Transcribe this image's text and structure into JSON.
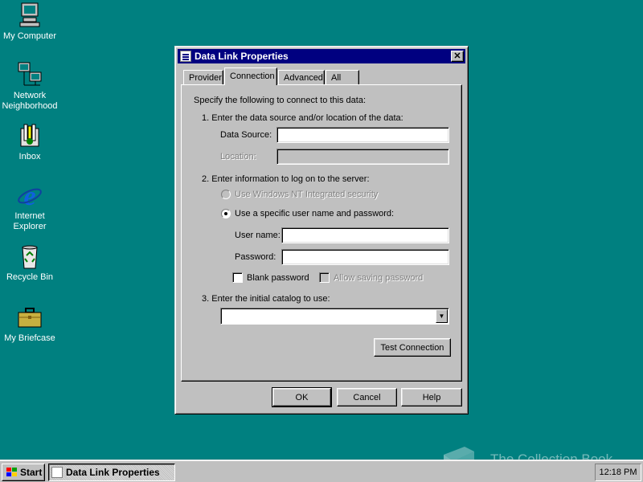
{
  "desktop": {
    "icons": [
      {
        "label": "My Computer"
      },
      {
        "label": "Network Neighborhood"
      },
      {
        "label": "Inbox"
      },
      {
        "label": "Internet Explorer"
      },
      {
        "label": "Recycle Bin"
      },
      {
        "label": "My Briefcase"
      }
    ]
  },
  "window": {
    "title": "Data Link Properties",
    "close_glyph": "✕",
    "tabs": [
      {
        "label": "Provider"
      },
      {
        "label": "Connection",
        "active": true
      },
      {
        "label": "Advanced"
      },
      {
        "label": "All"
      }
    ],
    "connection": {
      "intro": "Specify the following to connect to this data:",
      "step1": "1. Enter the data source and/or location of the data:",
      "data_source_label": "Data Source:",
      "data_source_value": "",
      "location_label": "Location:",
      "location_value": "",
      "step2": "2. Enter information to log on to the server:",
      "radio_nt": "Use Windows NT Integrated security",
      "radio_specific": "Use a specific user name and password:",
      "radio_specific_selected": true,
      "username_label": "User name:",
      "username_value": "",
      "password_label": "Password:",
      "password_value": "",
      "blank_password": "Blank password",
      "blank_password_checked": false,
      "allow_saving": "Allow saving password",
      "allow_saving_checked": false,
      "step3": "3. Enter the initial catalog to use:",
      "catalog_value": "",
      "test_connection": "Test Connection"
    },
    "buttons": {
      "ok": "OK",
      "cancel": "Cancel",
      "help": "Help"
    }
  },
  "taskbar": {
    "start": "Start",
    "task": "Data Link Properties",
    "clock": "12:18 PM"
  },
  "watermark": "The Collection Book"
}
